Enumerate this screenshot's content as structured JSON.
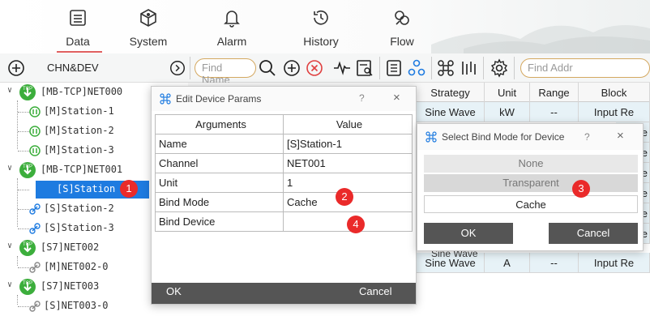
{
  "top_tabs": [
    {
      "label": "Data",
      "icon": "data-list-icon",
      "active": true
    },
    {
      "label": "System",
      "icon": "system-cube-icon",
      "active": false
    },
    {
      "label": "Alarm",
      "icon": "bell-icon",
      "active": false
    },
    {
      "label": "History",
      "icon": "history-clock-icon",
      "active": false
    },
    {
      "label": "Flow",
      "icon": "flow-icon",
      "active": false
    }
  ],
  "toolbar": {
    "chn_dev_label": "CHN&DEV",
    "find_name_placeholder": "Find Name",
    "find_addr_placeholder": "Find Addr"
  },
  "tree": [
    {
      "label": "[MB-TCP]NET000",
      "type": "channel"
    },
    {
      "label": "[M]Station-1",
      "type": "device"
    },
    {
      "label": "[M]Station-2",
      "type": "device"
    },
    {
      "label": "[M]Station-3",
      "type": "device"
    },
    {
      "label": "[MB-TCP]NET001",
      "type": "channel"
    },
    {
      "label": "[S]Station-1",
      "display": "[S]Station",
      "type": "device",
      "selected": true
    },
    {
      "label": "[S]Station-2",
      "type": "device"
    },
    {
      "label": "[S]Station-3",
      "type": "device"
    },
    {
      "label": "[S7]NET002",
      "type": "channel"
    },
    {
      "label": "[M]NET002-0",
      "type": "device"
    },
    {
      "label": "[S7]NET003",
      "type": "channel"
    },
    {
      "label": "[S]NET003-0",
      "type": "device"
    }
  ],
  "table": {
    "headers": [
      "Strategy",
      "Unit",
      "Range",
      "Block"
    ],
    "rows": [
      [
        "Sine Wave",
        "kW",
        "--",
        "Input Re"
      ],
      [
        "Sine Wave",
        "A",
        "--",
        "Input Re"
      ]
    ],
    "partial_block_texts": [
      "Re",
      "Re",
      "Re",
      "Re",
      "Re",
      "Re"
    ]
  },
  "edit_dialog": {
    "title": "Edit Device Params",
    "help": "?",
    "close": "×",
    "col_arguments": "Arguments",
    "col_value": "Value",
    "rows": [
      {
        "arg": "Name",
        "value": "[S]Station-1"
      },
      {
        "arg": "Channel",
        "value": "NET001"
      },
      {
        "arg": "Unit",
        "value": "1"
      },
      {
        "arg": "Bind Mode",
        "value": "Cache"
      },
      {
        "arg": "Bind Device",
        "value": ""
      }
    ],
    "ok": "OK",
    "cancel": "Cancel"
  },
  "bind_dialog": {
    "title": "Select Bind Mode for Device",
    "help": "?",
    "close": "×",
    "options": [
      "None",
      "Transparent",
      "Cache"
    ],
    "selected": "Cache",
    "ok": "OK",
    "cancel": "Cancel",
    "bg_partial_text": "Sine Wave"
  },
  "badges": [
    "1",
    "2",
    "3",
    "4"
  ],
  "colors": {
    "accent_red": "#ea2a2a",
    "select_blue": "#1e7be0",
    "tcp_green": "#3cae3c",
    "pill_border": "#d4a860"
  }
}
